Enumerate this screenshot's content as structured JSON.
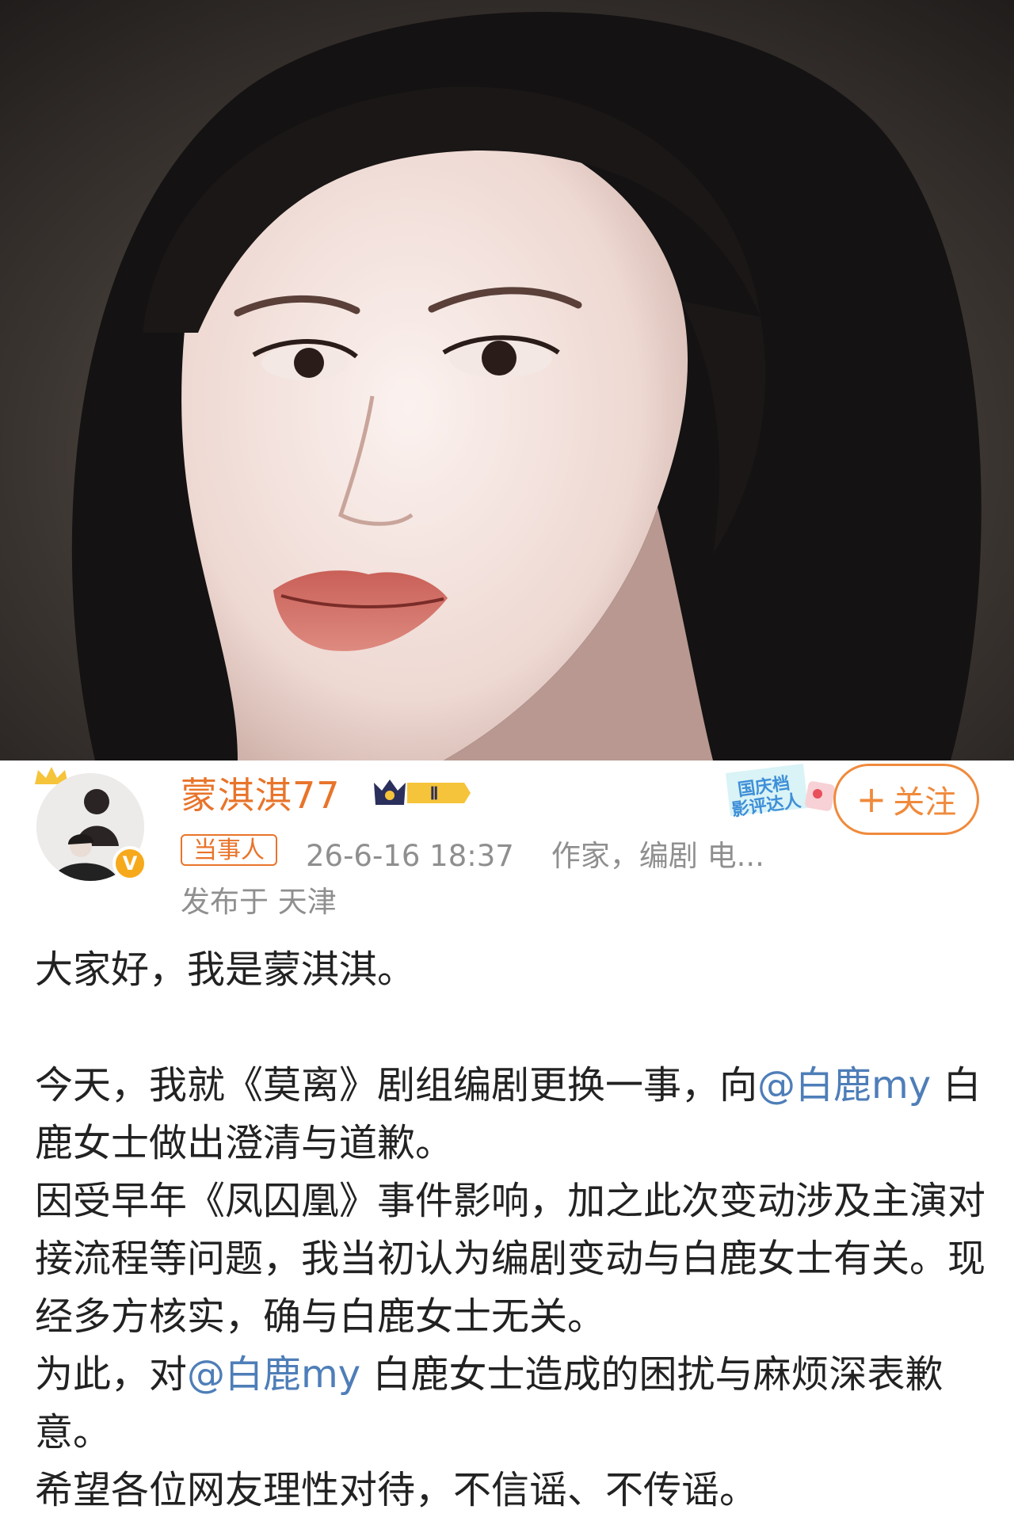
{
  "post": {
    "image_alt": "",
    "author": {
      "name": "蒙淇淇77",
      "level": "Ⅱ",
      "verified_icon": "v-verified-icon",
      "tag": "当事人",
      "timestamp": "26-6-16 18:37",
      "bio": "作家，编剧 电...",
      "location": "发布于 天津"
    },
    "badge": {
      "line1": "国庆档",
      "line2": "影评达人"
    },
    "follow": {
      "plus": "+",
      "label": "关注"
    },
    "content": {
      "line1": "大家好，我是蒙淇淇。",
      "p2_pre": "今天，我就《莫离》剧组编剧更换一事，向",
      "p2_mention": "@白鹿my",
      "p2_post": " 白鹿女士做出澄清与道歉。",
      "p3": "因受早年《凤囚凰》事件影响，加之此次变动涉及主演对接流程等问题，我当初认为编剧变动与白鹿女士有关。现经多方核实，确与白鹿女士无关。",
      "p4_pre": "为此，对",
      "p4_mention": "@白鹿my",
      "p4_post": " 白鹿女士造成的困扰与麻烦深表歉意。",
      "p5": "希望各位网友理性对待，不信谣、不传谣。"
    }
  },
  "colors": {
    "username": "#e8742a",
    "mention": "#4e7eb8",
    "follow": "#f08a3c",
    "meta": "#8f8f8f",
    "text": "#222222"
  }
}
